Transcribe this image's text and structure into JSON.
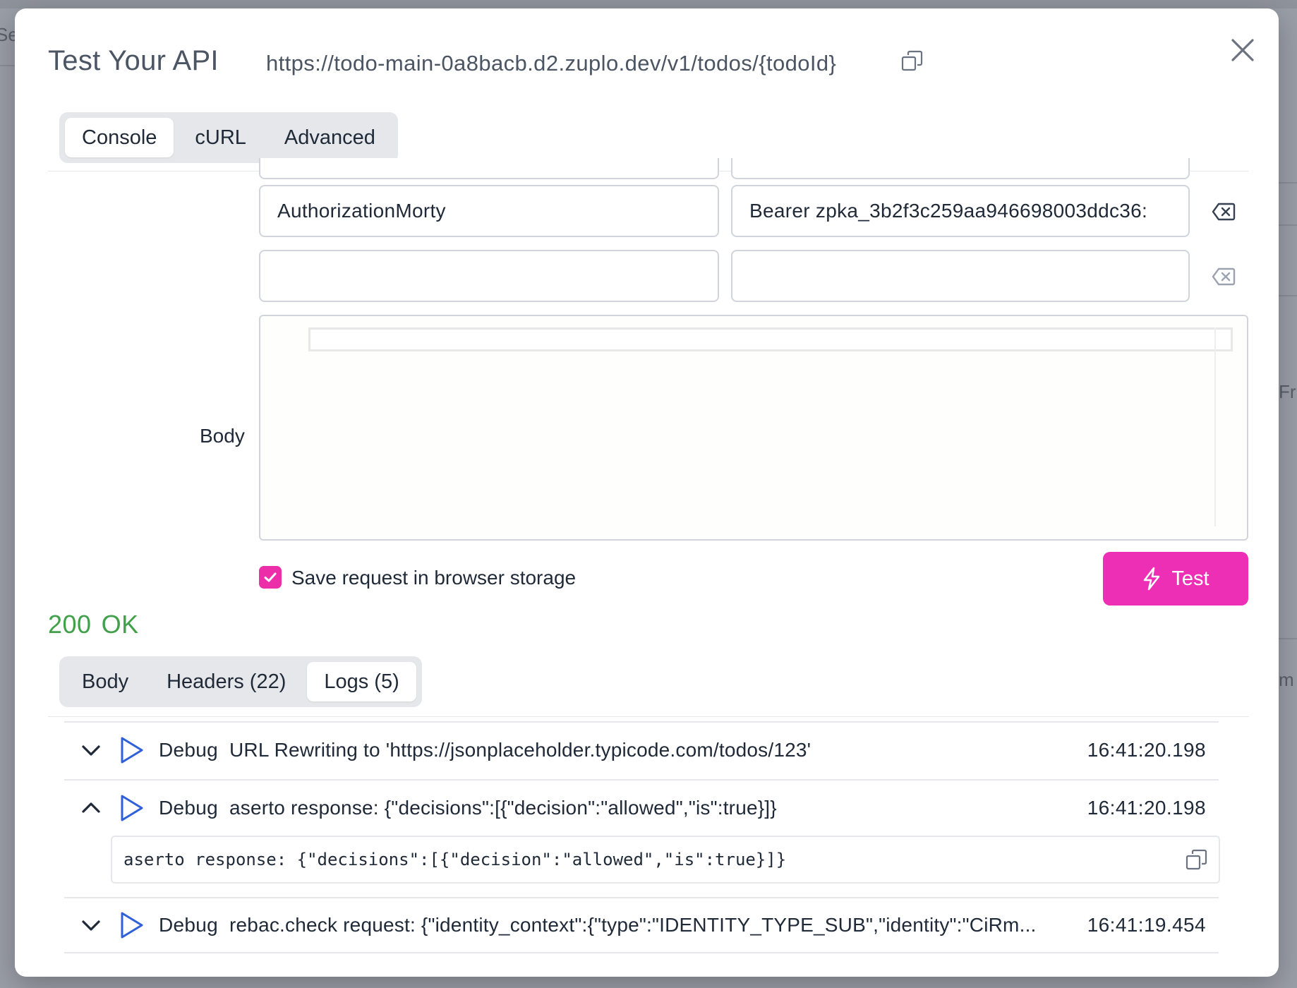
{
  "modal": {
    "title": "Test Your API",
    "url": "https://todo-main-0a8bacb.d2.zuplo.dev/v1/todos/{todoId}"
  },
  "request_tabs": [
    {
      "label": "Console",
      "active": true
    },
    {
      "label": "cURL",
      "active": false
    },
    {
      "label": "Advanced",
      "active": false
    }
  ],
  "headers": [
    {
      "name": "AuthorizationMorty",
      "value": "Bearer zpka_3b2f3c259aa946698003ddc36:"
    },
    {
      "name": "",
      "value": ""
    }
  ],
  "body": {
    "label": "Body"
  },
  "save_request": {
    "label": "Save request in browser storage",
    "checked": true
  },
  "test_button": {
    "label": "Test"
  },
  "response": {
    "status_code": "200",
    "status_text": "OK"
  },
  "response_tabs": [
    {
      "label": "Body",
      "active": false
    },
    {
      "label": "Headers (22)",
      "active": false
    },
    {
      "label": "Logs (5)",
      "active": true
    }
  ],
  "logs": [
    {
      "level": "Debug",
      "message": "URL Rewriting to 'https://jsonplaceholder.typicode.com/todos/123'",
      "time": "16:41:20.198",
      "expanded": false
    },
    {
      "level": "Debug",
      "message": "aserto response: {\"decisions\":[{\"decision\":\"allowed\",\"is\":true}]}",
      "time": "16:41:20.198",
      "expanded": true,
      "detail": "aserto response: {\"decisions\":[{\"decision\":\"allowed\",\"is\":true}]}"
    },
    {
      "level": "Debug",
      "message": "rebac.check request: {\"identity_context\":{\"type\":\"IDENTITY_TYPE_SUB\",\"identity\":\"CiRm...",
      "time": "16:41:19.454",
      "expanded": false
    }
  ],
  "background": {
    "fragments": [
      "Se",
      "Fr",
      "m"
    ]
  },
  "colors": {
    "accent": "#ec2fb4",
    "status_ok": "#41a04a",
    "play_icon": "#2f5fd9"
  }
}
